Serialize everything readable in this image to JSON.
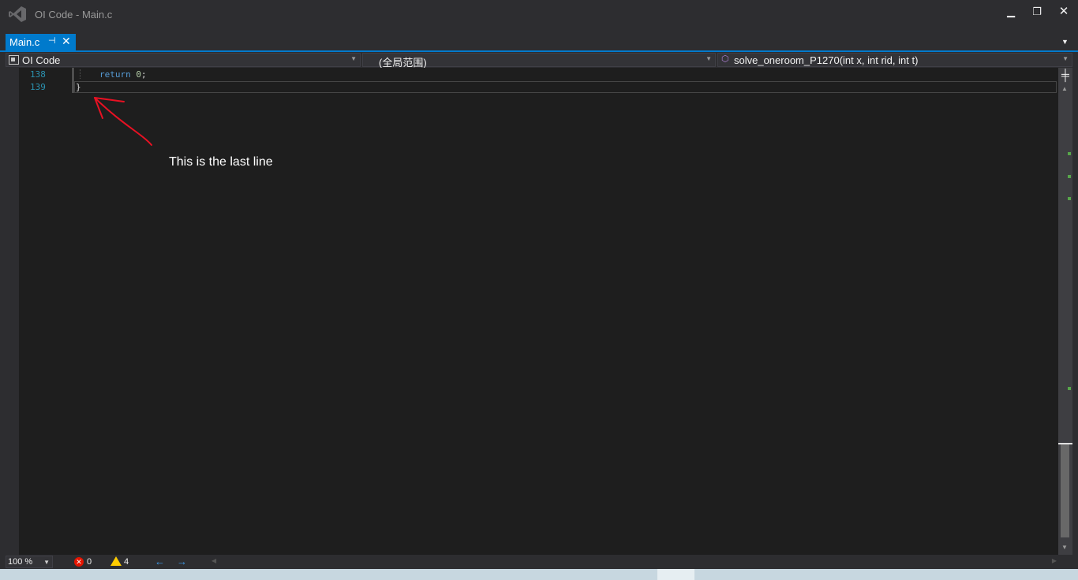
{
  "window": {
    "title": "OI Code - Main.c",
    "minimize_glyph": "▁",
    "restore_glyph": "❐",
    "close_glyph": "✕"
  },
  "tabs": [
    {
      "label": "Main.c",
      "pin_glyph": "⊣",
      "close_glyph": "✕",
      "active": true
    }
  ],
  "navbar": {
    "project": "OI Code",
    "scope": "(全局范围)",
    "member": "solve_oneroom_P1270(int x, int rid, int t)"
  },
  "editor": {
    "lines": [
      {
        "number": "138",
        "keyword": "return",
        "value": "0",
        "punct": ";"
      },
      {
        "number": "139",
        "text": "}"
      }
    ],
    "annotation": "This is the last line"
  },
  "footer": {
    "zoom": "100 %",
    "errors": "0",
    "warnings": "4"
  },
  "colors": {
    "accent": "#007acc",
    "editor_bg": "#1e1e1e",
    "chrome_bg": "#2d2d30",
    "line_number": "#2b91af",
    "keyword": "#569cd6",
    "annotation_arrow": "#e81123"
  }
}
